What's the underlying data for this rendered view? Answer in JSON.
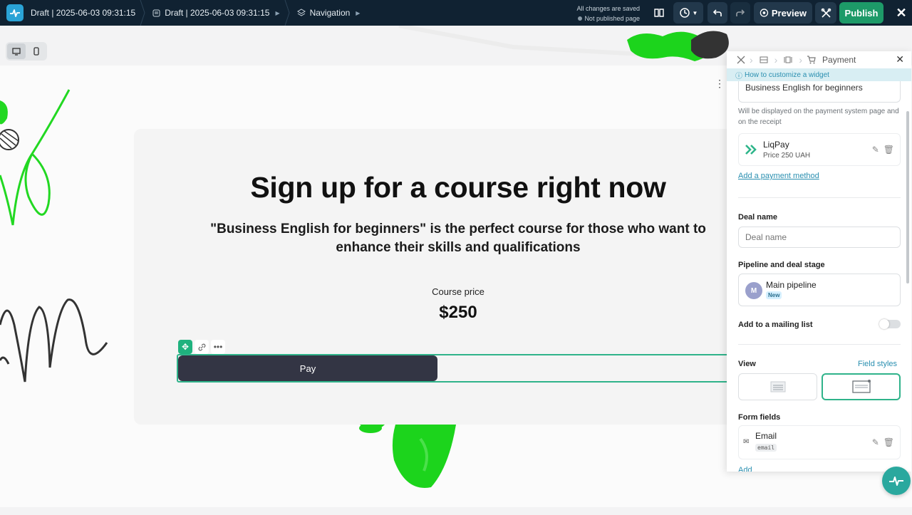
{
  "topbar": {
    "breadcrumbs": [
      {
        "label": "Draft | 2025-06-03 09:31:15"
      },
      {
        "label": "Draft | 2025-06-03 09:31:15"
      },
      {
        "label": "Navigation"
      }
    ],
    "save_status": "All changes are saved",
    "publish_status": "Not published page",
    "preview_label": "Preview",
    "publish_label": "Publish",
    "accent_color": "#1d9a68",
    "icons": [
      "app-logo-icon",
      "page-icon",
      "layers-icon",
      "book-icon",
      "history-icon",
      "undo-icon",
      "redo-icon",
      "eye-icon",
      "tools-icon",
      "close-icon"
    ]
  },
  "canvas": {
    "title": "Sign up for a course right now",
    "subtitle": "\"Business English for beginners\" is the perfect course for those who want to enhance their skills and qualifications",
    "price_label": "Course price",
    "price": "$250",
    "pay_button": "Pay"
  },
  "panel": {
    "breadcrumb_title": "Payment",
    "help_link": "How to customize a widget",
    "product_name_value": "Business English for beginners",
    "product_hint": "Will be displayed on the payment system page and on the receipt",
    "payment_method": {
      "name": "LiqPay",
      "detail": "Price 250 UAH"
    },
    "add_payment_method": "Add a payment method",
    "deal_name_label": "Deal name",
    "deal_name_placeholder": "Deal name",
    "pipeline_label": "Pipeline and deal stage",
    "pipeline": {
      "avatar": "M",
      "name": "Main pipeline",
      "stage": "New"
    },
    "mailing_label": "Add to a mailing list",
    "mailing_enabled": false,
    "view_label": "View",
    "field_styles_link": "Field styles",
    "form_fields_label": "Form fields",
    "form_field": {
      "name": "Email",
      "key": "email"
    },
    "add_field": "Add"
  }
}
